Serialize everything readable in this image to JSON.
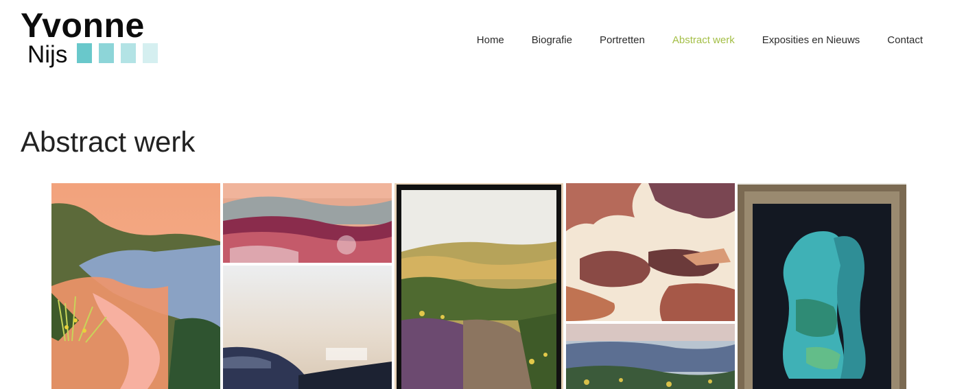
{
  "logo": {
    "line1": "Yvonne",
    "line2": "Nijs",
    "squares": [
      "#69c8cb",
      "#8dd5d8",
      "#b3e3e5",
      "#d5eff0"
    ]
  },
  "nav": {
    "items": [
      {
        "label": "Home",
        "active": false
      },
      {
        "label": "Biografie",
        "active": false
      },
      {
        "label": "Portretten",
        "active": false
      },
      {
        "label": "Abstract werk",
        "active": true
      },
      {
        "label": "Exposities en Nieuws",
        "active": false
      },
      {
        "label": "Contact",
        "active": false
      }
    ],
    "active_color": "#a3be45"
  },
  "page": {
    "title": "Abstract werk"
  },
  "gallery": {
    "images": [
      "coastal-landscape-painting",
      "pink-heather-painting",
      "misty-landscape-painting",
      "framed-heath-path-painting",
      "abstract-rocks-painting",
      "blue-landscape-painting",
      "framed-torso-painting"
    ]
  }
}
